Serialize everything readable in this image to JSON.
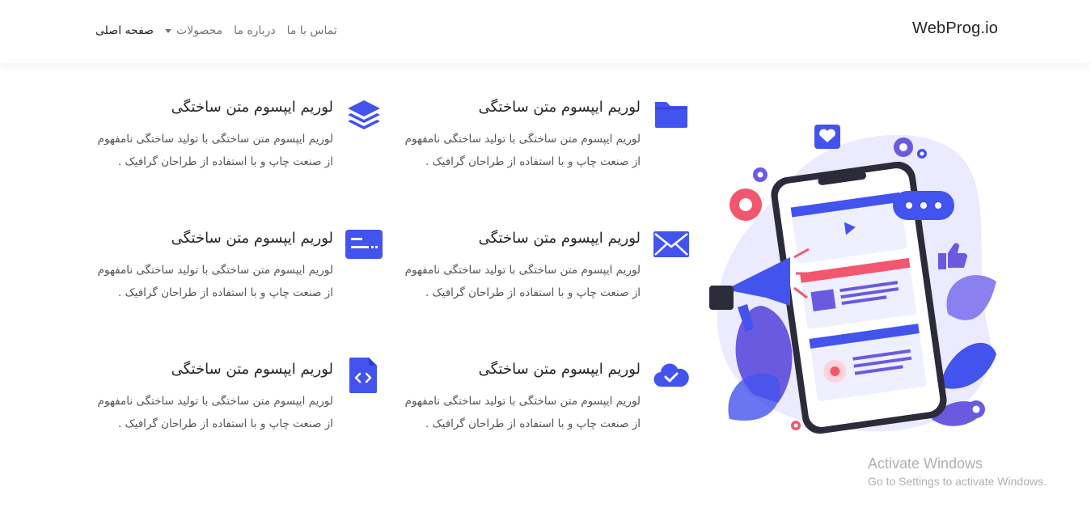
{
  "navbar": {
    "brand": "WebProg.io",
    "links": [
      {
        "label": "صفحه اصلی"
      },
      {
        "label": "محصولات"
      },
      {
        "label": "درباره ما"
      },
      {
        "label": "تماس با ما"
      }
    ]
  },
  "features": [
    {
      "icon": "folder-icon",
      "title": "لوریم ایپسوم متن ساختگی",
      "text": "لوریم ایپسوم متن ساختگی با تولید ساختگی نامفهوم از صنعت چاپ و با استفاده از طراحان گرافیک ."
    },
    {
      "icon": "layers-icon",
      "title": "لوریم ایپسوم متن ساختگی",
      "text": "لوریم ایپسوم متن ساختگی با تولید ساختگی نامفهوم از صنعت چاپ و با استفاده از طراحان گرافیک ."
    },
    {
      "icon": "envelope-icon",
      "title": "لوریم ایپسوم متن ساختگی",
      "text": "لوریم ایپسوم متن ساختگی با تولید ساختگی نامفهوم از صنعت چاپ و با استفاده از طراحان گرافیک ."
    },
    {
      "icon": "card-icon",
      "title": "لوریم ایپسوم متن ساختگی",
      "text": "لوریم ایپسوم متن ساختگی با تولید ساختگی نامفهوم از صنعت چاپ و با استفاده از طراحان گرافیک ."
    },
    {
      "icon": "cloud-check-icon",
      "title": "لوریم ایپسوم متن ساختگی",
      "text": "لوریم ایپسوم متن ساختگی با تولید ساختگی نامفهوم از صنعت چاپ و با استفاده از طراحان گرافیک ."
    },
    {
      "icon": "code-file-icon",
      "title": "لوریم ایپسوم متن ساختگی",
      "text": "لوریم ایپسوم متن ساختگی با تولید ساختگی نامفهوم از صنعت چاپ و با استفاده از طراحان گرافیک ."
    }
  ],
  "illustration": {
    "icon": "phone-marketing-illustration"
  },
  "watermark": {
    "title": "Activate Windows",
    "subtitle": "Go to Settings to activate Windows."
  },
  "colors": {
    "accent": "#4353ee",
    "pink": "#f2576f",
    "lavender": "#eceaff"
  }
}
